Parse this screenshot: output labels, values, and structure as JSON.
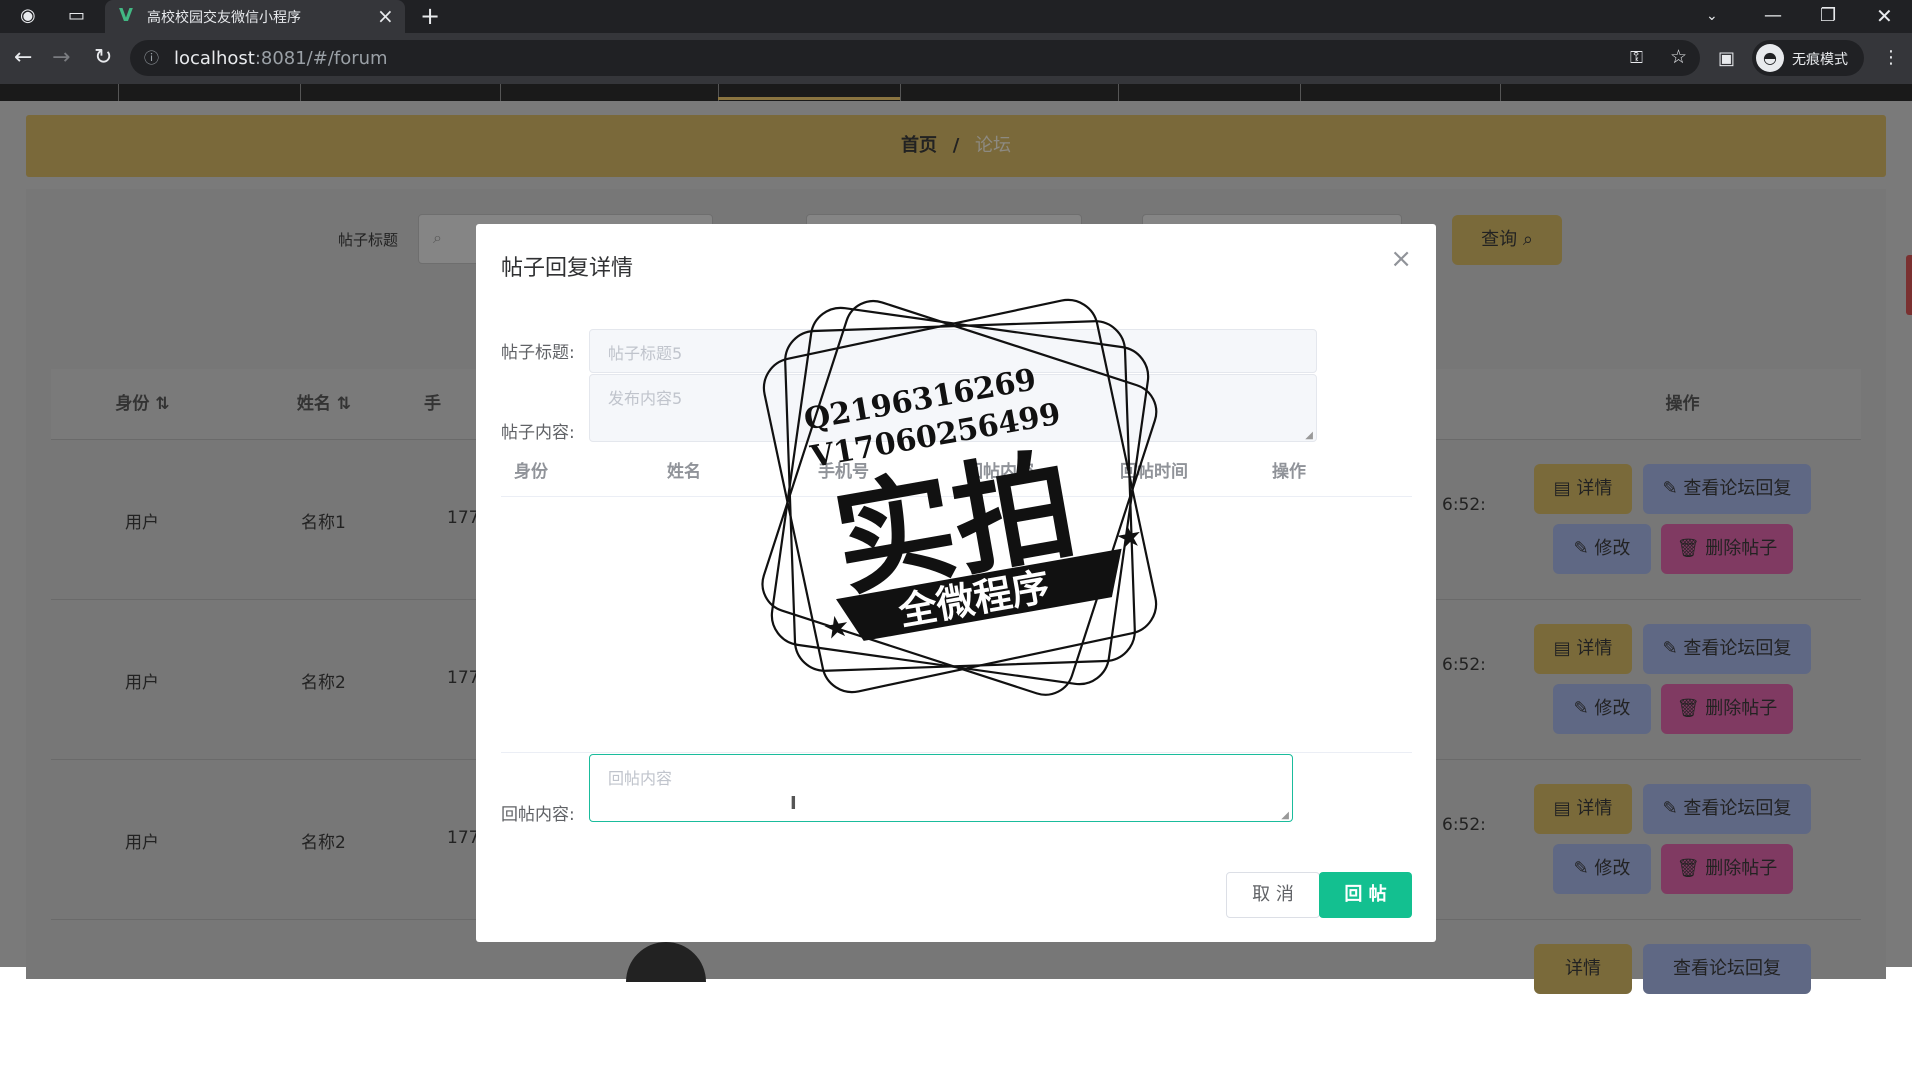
{
  "browser": {
    "tab_title": "高校校园交友微信小程序",
    "url_host": "localhost",
    "url_rest": ":8081/#/forum",
    "incognito_label": "无痕模式"
  },
  "breadcrumb": {
    "home": "首页",
    "sep": "/",
    "current": "论坛"
  },
  "search": {
    "label": "帖子标题",
    "button": "查询"
  },
  "table": {
    "headers": [
      "身份",
      "姓名",
      "手",
      "操作"
    ],
    "rows": [
      {
        "identity": "用户",
        "name": "名称1",
        "phone": "177",
        "time": "6:52:"
      },
      {
        "identity": "用户",
        "name": "名称2",
        "phone": "177",
        "time": "6:52:"
      },
      {
        "identity": "用户",
        "name": "名称2",
        "phone": "177",
        "time": "6:52:"
      }
    ],
    "actions": {
      "detail": "详情",
      "view_reply": "查看论坛回复",
      "edit": "修改",
      "delete": "删除帖子"
    }
  },
  "modal": {
    "title": "帖子回复详情",
    "title_label": "帖子标题:",
    "title_value": "帖子标题5",
    "content_label": "帖子内容:",
    "content_value": "发布内容5",
    "columns": [
      "身份",
      "姓名",
      "手机号",
      "回帖内容",
      "回帖时间",
      "操作"
    ],
    "reply_label": "回帖内容:",
    "reply_placeholder": "回帖内容",
    "cancel": "取 消",
    "submit": "回 帖"
  },
  "stamp": {
    "line1": "Q2196316269",
    "line2": "V17060256499",
    "main": "实拍",
    "banner": "全微程序"
  }
}
